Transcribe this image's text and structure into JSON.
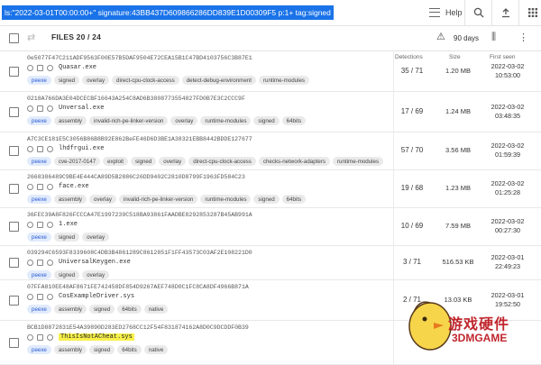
{
  "search": {
    "query": "ls:\"2022-03-01T00:00:00+\" signature:43BB437D609866286DD839E1D00309F5 p:1+ tag:signed"
  },
  "header": {
    "help_label": "Help"
  },
  "toolbar": {
    "files_label": "FILES 20 / 24",
    "days_label": "90 days"
  },
  "columns": {
    "detections": "Detections",
    "size": "Size",
    "first_seen": "First seen"
  },
  "rows": [
    {
      "hash": "0e5077F47C211ADF9563F00E57B5DAF9504E72CEA15B1C47BD4103756C3B87E1",
      "name": "Quasar.exe",
      "tags": [
        "peexe",
        "signed",
        "overlay",
        "direct-cpu-clock-access",
        "detect-debug-environment",
        "runtime-modules"
      ],
      "detections": "35 / 71",
      "size": "1.20 MB",
      "first_seen_date": "2022-03-02",
      "first_seen_time": "10:53:00"
    },
    {
      "hash": "0218A766DA3E04DCECBF16643A254C8AD6B3808773554827FD0B7E3C2CCC9F",
      "name": "Unversal.exe",
      "tags": [
        "peexe",
        "assembly",
        "invalid-rich-pe-linker-version",
        "overlay",
        "runtime-modules",
        "signed",
        "64bits"
      ],
      "detections": "17 / 69",
      "size": "1.24 MB",
      "first_seen_date": "2022-03-02",
      "first_seen_time": "03:48:35"
    },
    {
      "hash": "A7C3CE181E5C3056B86B8B92E862BeFE46D6D3BE1A38321EBB8442BDDE127677",
      "name": "lhdfrgui.exe",
      "tags": [
        "peexe",
        "cve-2017-0147",
        "exploit",
        "signed",
        "overlay",
        "direct-cpu-clock-access",
        "checks-network-adapters",
        "runtime-modules"
      ],
      "detections": "57 / 70",
      "size": "3.56 MB",
      "first_seen_date": "2022-03-02",
      "first_seen_time": "01:59:39"
    },
    {
      "hash": "2668386489C9BE4E444CA89D5B2886C26DD9402C2810D8799F1963FD584C23",
      "name": "face.exe",
      "tags": [
        "peexe",
        "assembly",
        "overlay",
        "invalid-rich-pe-linker-version",
        "runtime-modules",
        "signed",
        "64bits"
      ],
      "detections": "19 / 68",
      "size": "1.23 MB",
      "first_seen_date": "2022-03-02",
      "first_seen_time": "01:25:28"
    },
    {
      "hash": "36FEC39A8F826FCCCA47E1997239C518BA93861FAADBE8292853287B45AB991A",
      "name": "1.exe",
      "tags": [
        "peexe",
        "signed",
        "overlay"
      ],
      "detections": "10 / 69",
      "size": "7.59 MB",
      "first_seen_date": "2022-03-02",
      "first_seen_time": "00:27:30"
    },
    {
      "hash": "039294C6593F8339608C4DB3B4861289C8612851F1FF43573C03AF2E108221D0",
      "name": "UniversalKeygen.exe",
      "tags": [
        "peexe",
        "signed",
        "overlay"
      ],
      "detections": "3 / 71",
      "size": "516.53 KB",
      "first_seen_date": "2022-03-01",
      "first_seen_time": "22:49:23"
    },
    {
      "hash": "07FFA810EE48AF8671FE742458DF854D9267AEF748D0C1FC8CA8DF4966B871A",
      "name": "CosExampleDriver.sys",
      "tags": [
        "peexe",
        "assembly",
        "signed",
        "64bits",
        "native"
      ],
      "detections": "2 / 71",
      "size": "13.03 KB",
      "first_seen_date": "2022-03-01",
      "first_seen_time": "19:52:50"
    },
    {
      "hash": "BCB1D8872831E54A39890D283ED2768CC12F54F831874162A8D0C9DCDDF0B39",
      "name": "ThisIsNotACheat.sys",
      "tags": [
        "peexe",
        "assembly",
        "signed",
        "64bits",
        "native"
      ],
      "detections": "",
      "size": "",
      "first_seen_date": "",
      "first_seen_time": ""
    }
  ],
  "watermark": {
    "line1": "游戏硬件",
    "line2": "3DMGAME"
  }
}
